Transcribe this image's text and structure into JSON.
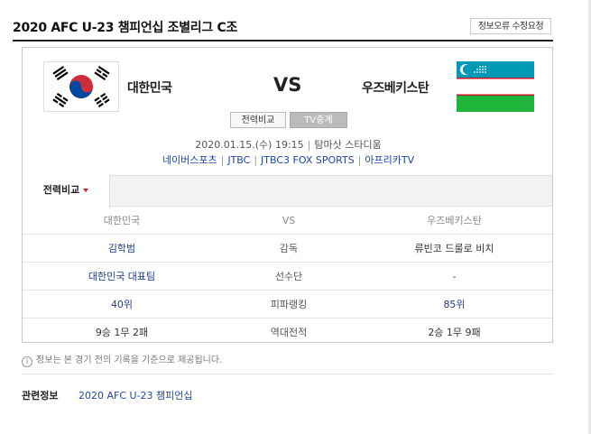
{
  "header": {
    "title": "2020 AFC U-23 챔피언십 조별리그 C조",
    "report_button": "정보오류 수정요청"
  },
  "match": {
    "home_team": "대한민국",
    "away_team": "우즈베키스탄",
    "vs": "VS",
    "buttons": {
      "compare": "전력비교",
      "tv": "TV중계"
    },
    "datetime": "2020.01.15.(수) 19:15",
    "venue": "탐마삿 스타디움",
    "broadcasters": [
      "네이버스포츠",
      "JTBC",
      "JTBC3 FOX SPORTS",
      "아프리카TV"
    ],
    "flags": {
      "home": "south-korea-flag-icon",
      "away": "uzbekistan-flag-icon"
    },
    "colors": {
      "kr_red": "#cd2e3a",
      "kr_blue": "#0047a0",
      "uz_blue": "#0099b5",
      "uz_green": "#1eb53a",
      "uz_red": "#ce1126"
    }
  },
  "tab": {
    "label": "전력비교"
  },
  "comparison": {
    "header": {
      "home": "대한민국",
      "stat": "VS",
      "away": "우즈베키스탄"
    },
    "rows": [
      {
        "home": "김학범",
        "stat": "감독",
        "away": "류빈코 드룰로 비치"
      },
      {
        "home": "대한민국 대표팀",
        "stat": "선수단",
        "away": "-"
      },
      {
        "home": "40위",
        "stat": "피파랭킹",
        "away": "85위"
      },
      {
        "home": "9승 1무 2패",
        "stat": "역대전적",
        "away": "2승 1무 9패"
      }
    ]
  },
  "footer": {
    "info_note": "정보는 본 경기 전의 기록을 기준으로 제공됩니다.",
    "related_label": "관련정보",
    "related_link": "2020 AFC U-23 챔피언십"
  }
}
